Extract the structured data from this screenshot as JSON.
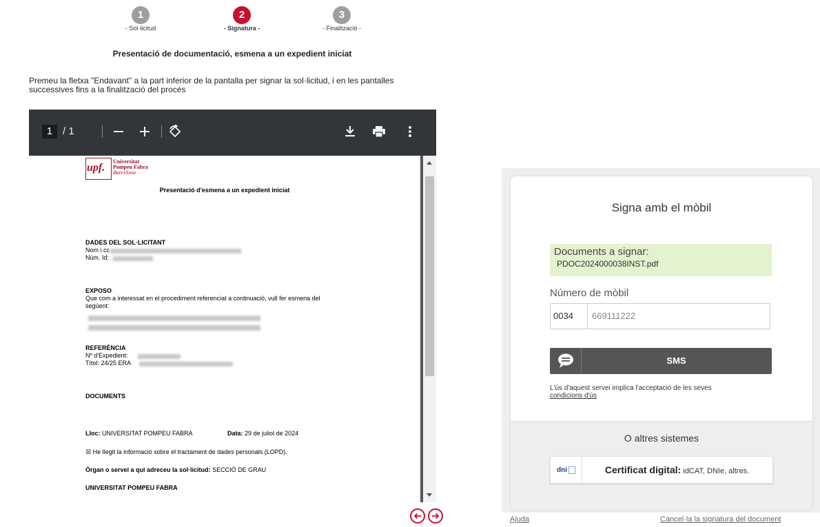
{
  "stepper": [
    {
      "num": "1",
      "label": "- Sol·licitud",
      "active": false
    },
    {
      "num": "2",
      "label": "- Signatura -",
      "active": true
    },
    {
      "num": "3",
      "label": "- Finalització -",
      "active": false
    }
  ],
  "title": "Presentació de documentació, esmena a un expedient iniciat",
  "instructions": "Premeu la fletxa \"Endavant\" a la part inferior de la pantalla per signar la sol·licitud, i en les pantalles successives fins a la finalització del procés",
  "viewer": {
    "page_current": "1",
    "page_total": "/  1",
    "pdf": {
      "logo_mark": "upf.",
      "logo_line1": "Universitat",
      "logo_line2": "Pompeu Fabra",
      "logo_line3": "Barcelona",
      "doc_title": "Presentació d'esmena a un expedient iniciat",
      "sec_applicant": "DADES DEL SOL·LICITANT",
      "name_label": "Nom i cc",
      "id_label": "Núm. Id:",
      "sec_expose": "EXPOSO",
      "expose_text": "Que com a interessat en el procediment referenciat a continuació, vull fer esmena del",
      "expose_text2": "següent:",
      "sec_reference": "REFERÈNCIA",
      "file_label": "Nº d'Expedient:",
      "title_label": "Títol: 24/25 ERA",
      "sec_documents": "DOCUMENTS",
      "place_label": "Lloc:",
      "place_value": "UNIVERSITAT POMPEU FABRA",
      "date_label": "Data:",
      "date_value": "29 de juliol de 2024",
      "lopd": "☒ He llegit la informació sobre el tractament de dades personals (LOPD).",
      "organ_label": "Òrgan o servei a qui adreceu la sol·licitud:",
      "organ_value": "SECCIÓ DE GRAU",
      "footer_org": "UNIVERSITAT POMPEU FABRA"
    }
  },
  "signing": {
    "title": "Signa amb el mòbil",
    "docs_heading": "Documents a signar:",
    "docs_file": "PDOC2024000038INST.pdf",
    "mobile_label": "Número de mòbil",
    "prefix": "0034",
    "mobile_placeholder": "669111222",
    "sms_label": "SMS",
    "terms_text": "L'ús d'aquest servei implica l'acceptació de les seves",
    "terms_link": "condicions d'ús",
    "other_heading": "O altres sistemes",
    "dni_mark": "dni",
    "cert_bold": "Certificat digital:",
    "cert_rest": " idCAT, DNIe, altres.",
    "help": "Ajuda",
    "cancel": "Cancel·la la signatura del document"
  },
  "colors": {
    "accent": "#c8102e",
    "inactive_step": "#9e9e9e",
    "toolbar": "#323639",
    "docs_bg": "#e4f2cf",
    "sms_bg": "#555555"
  }
}
